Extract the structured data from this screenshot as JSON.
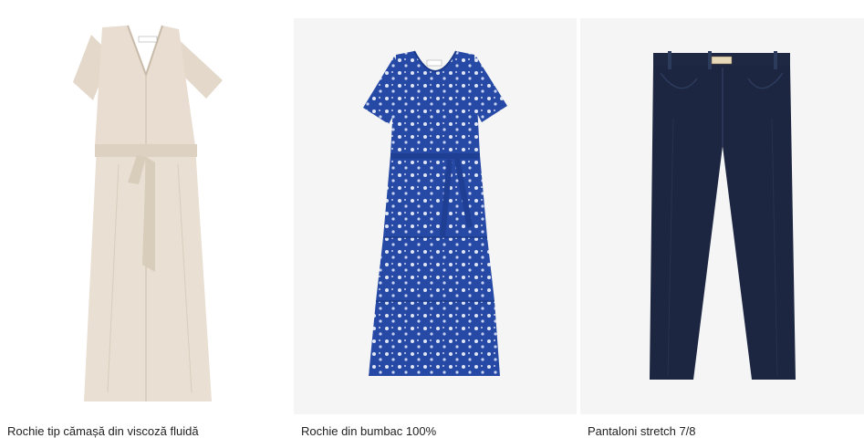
{
  "products": [
    {
      "name": "Rochie tip cămașă din viscoză fluidă",
      "image": "beige-shirt-dress",
      "color": "#e6dccf"
    },
    {
      "name": "Rochie din bumbac 100%",
      "image": "blue-floral-dress",
      "color": "#2749a6"
    },
    {
      "name": "Pantaloni stretch 7/8",
      "image": "navy-trousers",
      "color": "#1c2640"
    }
  ]
}
